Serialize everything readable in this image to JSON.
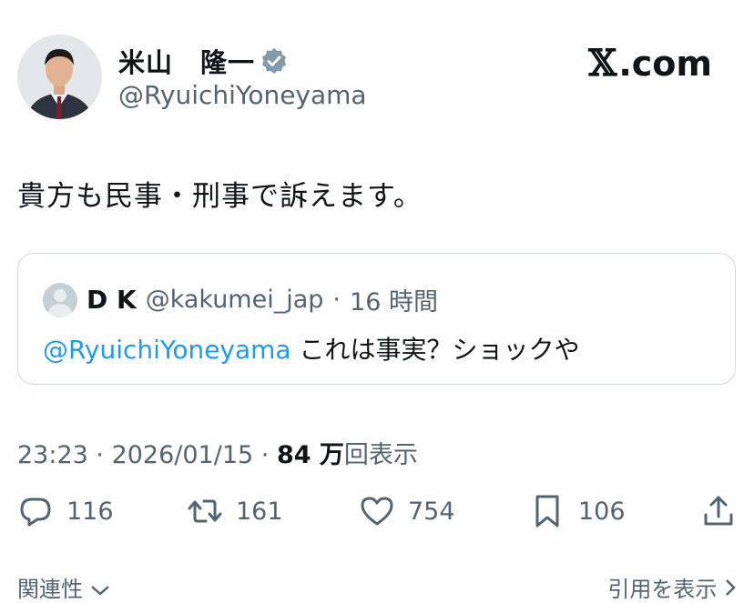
{
  "author": {
    "display_name": "米山　隆一",
    "handle": "@RyuichiYoneyama",
    "verified_icon": "verified-badge-icon",
    "avatar": "profile-photo"
  },
  "brand": {
    "logo_text": "𝕏",
    "domain_text": ".com"
  },
  "tweet": {
    "text": "貴方も民事・刑事で訴えます。"
  },
  "quoted_tweet": {
    "name": "D K",
    "handle": "@kakumei_jap",
    "separator": "·",
    "time": "16 時間",
    "mention": "@RyuichiYoneyama",
    "text": " これは事実？ショックや"
  },
  "meta": {
    "time": "23:23",
    "sep1": " · ",
    "date": "2026/01/15",
    "sep2": " · ",
    "views_count": "84 万",
    "views_label": "回表示"
  },
  "actions": {
    "replies": "116",
    "retweets": "161",
    "likes": "754",
    "bookmarks": "106",
    "icons": [
      "reply-icon",
      "retweet-icon",
      "like-icon",
      "bookmark-icon",
      "share-icon"
    ]
  },
  "footer": {
    "related_label": "関連性",
    "quotes_label": "引用を表示"
  },
  "colors": {
    "text": "#0f1419",
    "secondary": "#536471",
    "link": "#1d9bf0",
    "verified": "#829aab",
    "border": "#cfd9de"
  }
}
